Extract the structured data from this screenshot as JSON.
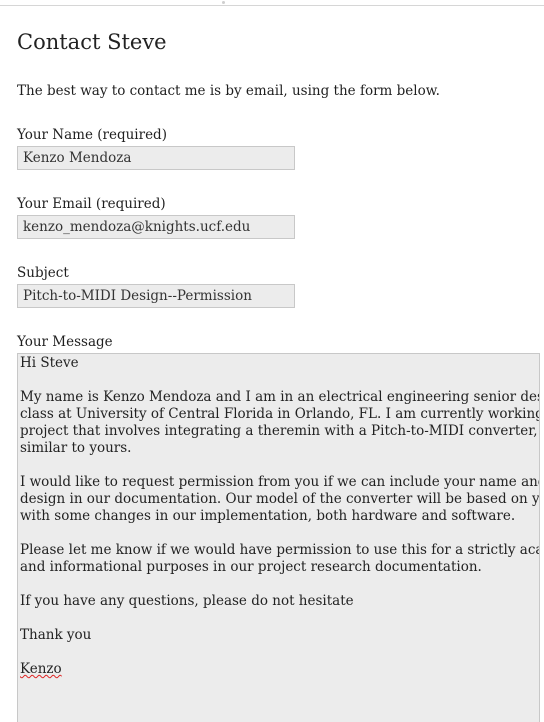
{
  "page": {
    "title": "Contact Steve",
    "intro": "The best way to contact me is by email,  using the form below."
  },
  "form": {
    "name": {
      "label": "Your Name (required)",
      "value": "Kenzo Mendoza"
    },
    "email": {
      "label": "Your Email (required)",
      "value": "kenzo_mendoza@knights.ucf.edu"
    },
    "subject": {
      "label": "Subject",
      "value": "Pitch-to-MIDI Design--Permission"
    },
    "message": {
      "label": "Your Message",
      "lines": [
        "Hi Steve",
        "",
        "My name is Kenzo Mendoza and I am in an electrical engineering senior design",
        "class at University of Central Florida in Orlando, FL. I am currently working on a",
        "project that involves integrating a theremin with a Pitch-to-MIDI converter,",
        "similar to yours.",
        "",
        "I would like to request permission from you if we can include your name and your",
        "design in our documentation. Our model of the converter will be based on yours,",
        "with some  changes in our implementation, both hardware and software.",
        "",
        "Please let me know if we would have permission to use this for a strictly academic",
        "and informational purposes in our project research documentation.",
        "",
        "If you have any questions, please do not hesitate",
        "",
        "Thank you",
        "",
        "Kenzo"
      ]
    }
  }
}
